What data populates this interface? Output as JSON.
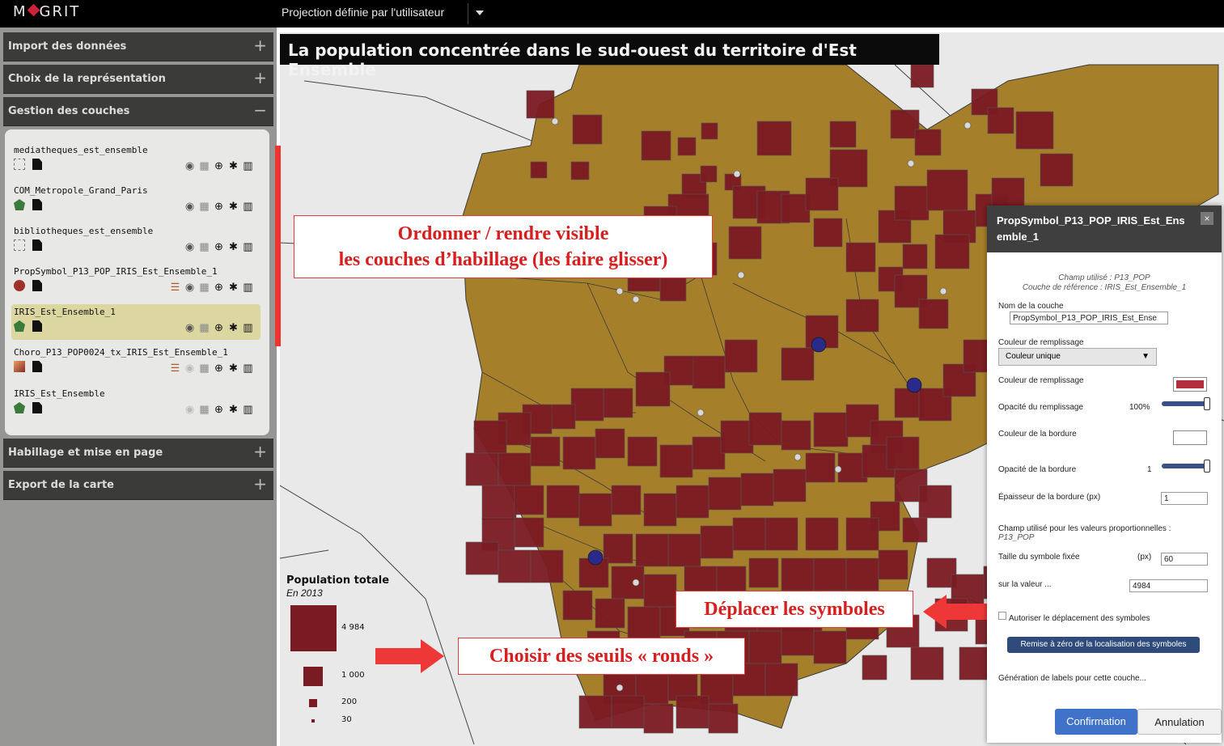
{
  "topbar": {
    "logo_left": "M",
    "logo_right": "GRIT",
    "projection": "Projection définie par l'utilisateur"
  },
  "sidebar": {
    "sections": [
      {
        "label": "Import des données",
        "sign": "+"
      },
      {
        "label": "Choix de la représentation",
        "sign": "+"
      },
      {
        "label": "Gestion des couches",
        "sign": "−"
      },
      {
        "label": "Habillage et mise en page",
        "sign": "+"
      },
      {
        "label": "Export de la carte",
        "sign": "+"
      }
    ],
    "layers": [
      {
        "name": "mediatheques_est_ensemble",
        "icon": "point-layer-icon"
      },
      {
        "name": "COM_Metropole_Grand_Paris",
        "icon": "polygon-layer-icon"
      },
      {
        "name": "bibliotheques_est_ensemble",
        "icon": "point-layer-icon"
      },
      {
        "name": "PropSymbol_P13_POP_IRIS_Est_Ensemble_1",
        "icon": "propsymbol-layer-icon"
      },
      {
        "name": "IRIS_Est_Ensemble_1",
        "icon": "polygon-layer-icon"
      },
      {
        "name": "Choro_P13_POP0024_tx_IRIS_Est_Ensemble_1",
        "icon": "choropleth-layer-icon"
      },
      {
        "name": "IRIS_Est_Ensemble",
        "icon": "polygon-layer-icon"
      }
    ]
  },
  "map": {
    "title": "La population concentrée dans le sud-ouest du territoire d'Est Ensemble",
    "fill_color": "#a57f2a",
    "symbol_color": "#7a1a22"
  },
  "legend": {
    "title": "Population totale",
    "subtitle": "En 2013",
    "entries": [
      {
        "label": "4 984",
        "value": 4984
      },
      {
        "label": "1 000",
        "value": 1000
      },
      {
        "label": "200",
        "value": 200
      },
      {
        "label": "30",
        "value": 30
      }
    ]
  },
  "annotations": {
    "layers_line1": "Ordonner / rendre visible",
    "layers_line2": "les couches d’habillage (les faire glisser)",
    "move": "Déplacer les symboles",
    "thresholds": "Choisir des seuils « ronds »"
  },
  "dialog": {
    "title": "PropSymbol_P13_POP_IRIS_Est_Ensemble_1",
    "close": "×",
    "field_used": "Champ utilisé : P13_POP",
    "ref_layer": "Couche de référence : IRIS_Est_Ensemble_1",
    "layer_name_label": "Nom de la couche",
    "layer_name_value": "PropSymbol_P13_POP_IRIS_Est_Ense",
    "fill_color_label": "Couleur de remplissage",
    "fill_mode": "Couleur unique",
    "fill_color_label2": "Couleur de remplissage",
    "fill_color": "#b1303c",
    "fill_opacity_label": "Opacité du remplissage",
    "fill_opacity_value": "100%",
    "border_color_label": "Couleur de la bordure",
    "border_color": "#ffffff",
    "border_opacity_label": "Opacité de la bordure",
    "border_opacity_value": "1",
    "border_width_label": "Épaisseur de la bordure (px)",
    "border_width_value": "1",
    "prop_field_label": "Champ utilisé pour les valeurs proportionnelles :",
    "prop_field_value": "P13_POP",
    "symbol_size_label": "Taille du symbole fixée",
    "symbol_size_unit": "(px)",
    "symbol_size_value": "60",
    "on_value_label": "sur la valeur ...",
    "on_value_value": "4984",
    "allow_move_label": "Autoriser le déplacement des symboles",
    "reset_button": "Remise à zéro de la localisation des symboles",
    "labels_label": "Génération de labels pour cette couche...",
    "confirm_button": "Confirmation",
    "cancel_button": "Annulation"
  }
}
